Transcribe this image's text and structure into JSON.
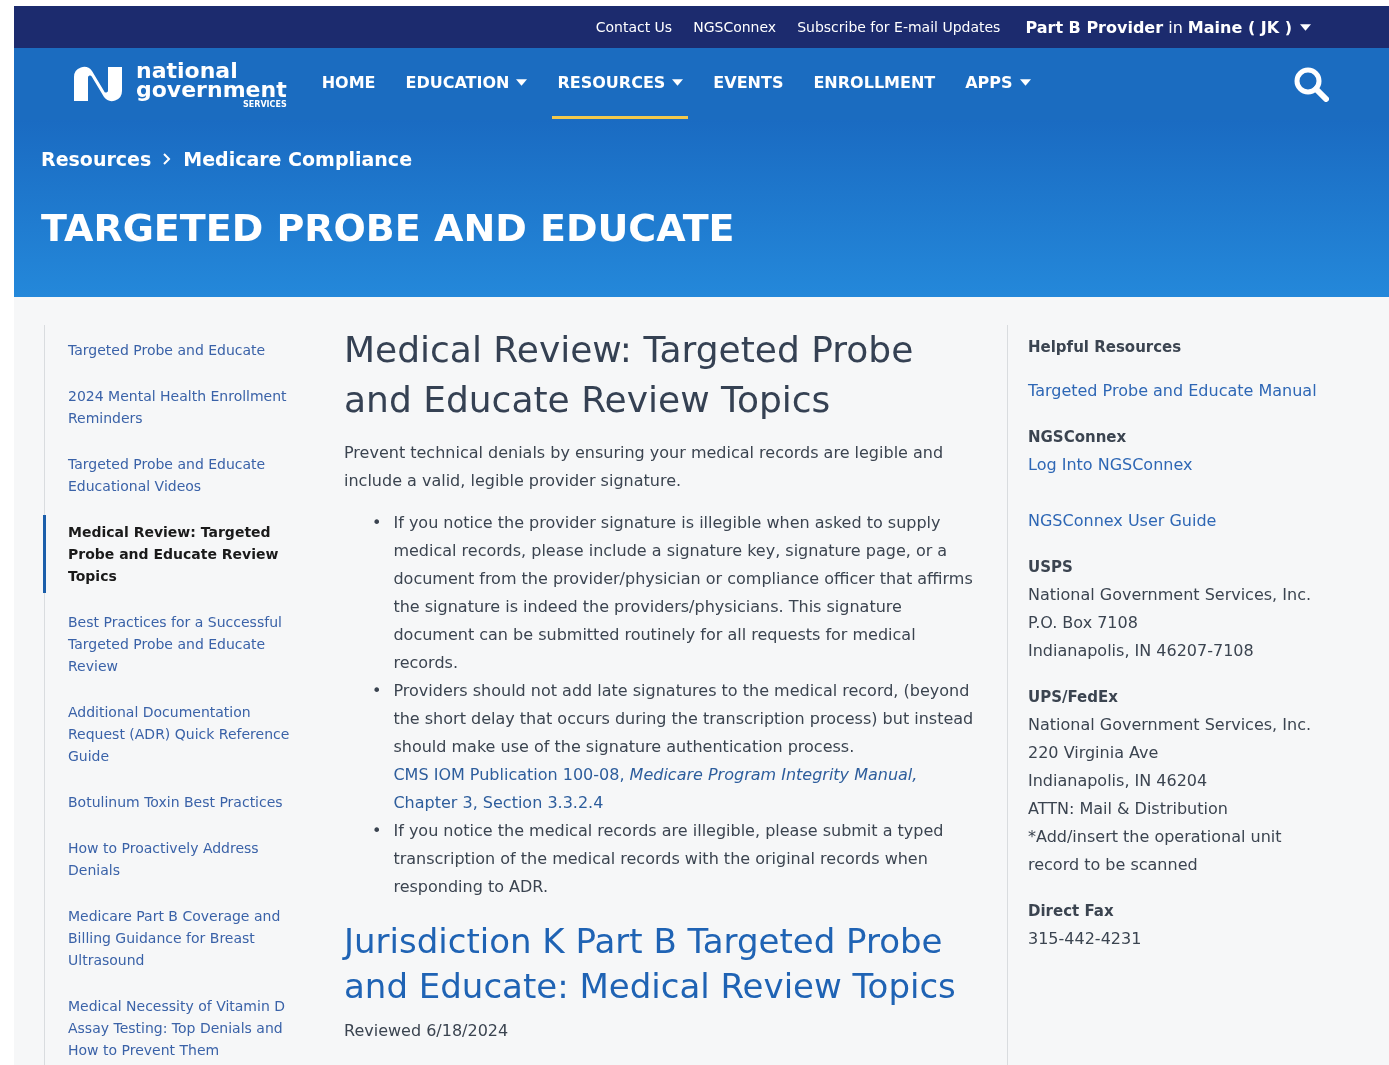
{
  "top_bar": {
    "links": [
      "Contact Us",
      "NGSConnex",
      "Subscribe for E-mail Updates"
    ],
    "region": "**Part B Provider** in **Maine ( JK )**"
  },
  "logo": {
    "line_1": "national",
    "line_2": "government",
    "line_3": "SERVICES"
  },
  "nav": [
    {
      "label": "HOME",
      "dropdown": false,
      "selected": false
    },
    {
      "label": "EDUCATION",
      "dropdown": true,
      "selected": false
    },
    {
      "label": "RESOURCES",
      "dropdown": true,
      "selected": true
    },
    {
      "label": "EVENTS",
      "dropdown": false,
      "selected": false
    },
    {
      "label": "ENROLLMENT",
      "dropdown": false,
      "selected": false
    },
    {
      "label": "APPS",
      "dropdown": true,
      "selected": false
    }
  ],
  "breadcrumb": [
    "Resources",
    "Medicare Compliance"
  ],
  "page_title": "TARGETED PROBE AND EDUCATE",
  "sidebar": {
    "items": [
      {
        "label": "Targeted Probe and Educate",
        "selected": false
      },
      {
        "label": "2024 Mental Health Enrollment Reminders",
        "selected": false
      },
      {
        "label": "Targeted Probe and Educate Educational Videos",
        "selected": false
      },
      {
        "label": "Medical Review: Targeted Probe and Educate Review Topics",
        "selected": true
      },
      {
        "label": "Best Practices for a Successful Targeted Probe and Educate Review",
        "selected": false
      },
      {
        "label": "Additional Documentation Request (ADR) Quick Reference Guide",
        "selected": false
      },
      {
        "label": "Botulinum Toxin Best Practices",
        "selected": false
      },
      {
        "label": "How to Proactively Address Denials",
        "selected": false
      },
      {
        "label": "Medicare Part B Coverage and Billing Guidance for Breast Ultrasound",
        "selected": false
      },
      {
        "label": "Medical Necessity of Vitamin D Assay Testing: Top Denials and How to Prevent Them",
        "selected": false
      }
    ]
  },
  "main": {
    "heading": "Medical Review: Targeted Probe and Educate Review Topics",
    "intro": "Prevent technical denials by ensuring your medical records are legible and include a valid, legible provider signature.",
    "bullets": [
      {
        "marker": "•",
        "text": "If you notice the provider signature is illegible when asked to supply medical records, please include a signature key, signature page, or a document from the provider/physician or compliance officer that affirms the signature is indeed the providers/physicians. This signature document can be submitted routinely for all requests for medical records."
      },
      {
        "marker": "•",
        "text": "Providers should not add late signatures to the medical record, (beyond the short delay that occurs during the transcription process) but instead should make use of the signature authentication process.",
        "citation": "CMS IOM Publication 100-08, *Medicare Program Integrity Manual,* Chapter 3, Section 3.3.2.4"
      },
      {
        "marker": "•",
        "text": "If you notice the medical records are illegible, please submit a typed transcription of the medical records with the original records when responding to ADR."
      }
    ],
    "subheading": "Jurisdiction K Part B Targeted Probe and Educate: Medical Review Topics",
    "reviewed": "Reviewed 6/18/2024"
  },
  "aside": {
    "heading": "Helpful Resources",
    "blocks": [
      {
        "lines": [
          {
            "kind": "link",
            "text": "Targeted Probe and Educate Manual"
          }
        ]
      },
      {
        "title": "NGSConnex",
        "lines": [
          {
            "kind": "link",
            "text": "Log Into NGSConnex"
          },
          {
            "kind": "gap"
          },
          {
            "kind": "link",
            "text": "NGSConnex User Guide"
          }
        ]
      },
      {
        "title": "USPS",
        "lines": [
          {
            "kind": "text",
            "text": "National Government Services, Inc."
          },
          {
            "kind": "text",
            "text": "P.O. Box 7108"
          },
          {
            "kind": "text",
            "text": "Indianapolis, IN 46207-7108"
          }
        ]
      },
      {
        "title": "UPS/FedEx",
        "lines": [
          {
            "kind": "text",
            "text": "National Government Services, Inc."
          },
          {
            "kind": "text",
            "text": "220 Virginia Ave"
          },
          {
            "kind": "text",
            "text": "Indianapolis, IN 46204"
          },
          {
            "kind": "text",
            "text": "ATTN: Mail & Distribution"
          },
          {
            "kind": "text",
            "text": "*Add/insert the operational unit record to be scanned"
          }
        ]
      },
      {
        "title": "Direct Fax",
        "lines": [
          {
            "kind": "text",
            "text": "315-442-4231"
          }
        ]
      }
    ]
  }
}
